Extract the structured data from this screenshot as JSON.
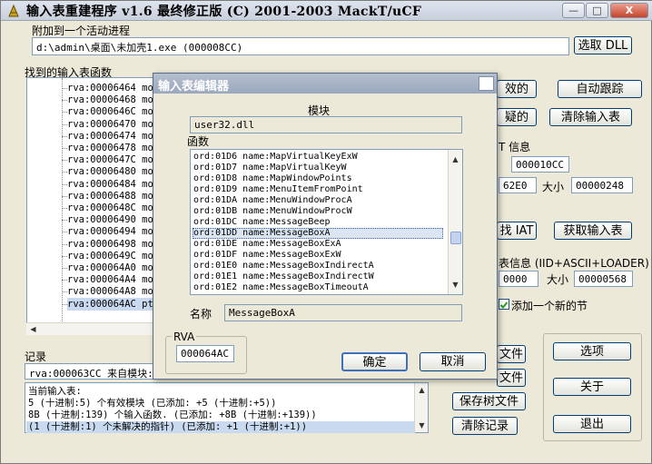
{
  "window": {
    "title": "输入表重建程序 v1.6 最终修正版 (C) 2001-2003 MackT/uCF",
    "min_label": "—",
    "max_label": "□",
    "close_label": "X"
  },
  "attach": {
    "label": "附加到一个活动进程",
    "process_value": "d:\\admin\\桌面\\未加壳1.exe (000008CC)",
    "pick_dll_button": "选取 DLL"
  },
  "tree": {
    "label": "找到的输入表函数",
    "rows": [
      "rva:00006464 mod",
      "rva:00006468 mod",
      "rva:0000646C mod",
      "rva:00006470 mod",
      "rva:00006474 mod",
      "rva:00006478 mod",
      "rva:0000647C mod",
      "rva:00006480 mod",
      "rva:00006484 mod",
      "rva:00006488 mod",
      "rva:0000648C mod",
      "rva:00006490 mod",
      "rva:00006494 mod",
      "rva:00006498 mod",
      "rva:0000649C mod",
      "rva:000064A0 mod",
      "rva:000064A4 mod",
      "rva:000064A8 mod",
      "rva:000064AC ptr"
    ],
    "selected_index": 18
  },
  "right_panel": {
    "show_valid_button": "效的",
    "auto_trace_button": "自动跟踪",
    "show_suspect_button": "疑的",
    "clear_imports_button": "清除输入表",
    "iat_info_label": "T 信息",
    "oep_value": "000010CC",
    "rva_value": "62E0",
    "size_label_1": "大小",
    "size_value_1": "00000248",
    "iat_autosearch_button": "找 IAT",
    "get_imports_button": "获取输入表",
    "new_import_info_label": "表信息 (IID+ASCII+LOADER)",
    "new_import_rva_value": "0000",
    "size_label_2": "大小",
    "size_value_2": "00000568",
    "add_section_label": "添加一个新的节",
    "add_section_checked": true
  },
  "log": {
    "label": "记录",
    "first_line": "rva:000063CC 来自模块:n",
    "lines": [
      "当前输入表:",
      "5 (十进制:5) 个有效模块 (已添加: +5 (十进制:+5))",
      "8B (十进制:139) 个输入函数. (已添加: +8B (十进制:+139))",
      "(1 (十进制:1) 个未解决的指针) (已添加: +1 (十进制:+1))"
    ]
  },
  "bottom_buttons": {
    "load_tree_button": "文件",
    "save_tree_file_button": "文件",
    "save_tree_button": "保存树文件",
    "clear_log_button": "清除记录",
    "options_button": "选项",
    "about_button": "关于",
    "exit_button": "退出"
  },
  "dialog": {
    "title": "输入表编辑器",
    "module_label": "模块",
    "module_value": "user32.dll",
    "functions_label": "函数",
    "functions": [
      "ord:01D6 name:MapVirtualKeyExW",
      "ord:01D7 name:MapVirtualKeyW",
      "ord:01D8 name:MapWindowPoints",
      "ord:01D9 name:MenuItemFromPoint",
      "ord:01DA name:MenuWindowProcA",
      "ord:01DB name:MenuWindowProcW",
      "ord:01DC name:MessageBeep",
      "ord:01DD name:MessageBoxA",
      "ord:01DE name:MessageBoxExA",
      "ord:01DF name:MessageBoxExW",
      "ord:01E0 name:MessageBoxIndirectA",
      "ord:01E1 name:MessageBoxIndirectW",
      "ord:01E2 name:MessageBoxTimeoutA"
    ],
    "selected_function_index": 7,
    "name_label": "名称",
    "name_value": "MessageBoxA",
    "rva_label": "RVA",
    "rva_value": "000064AC",
    "ok_button": "确定",
    "cancel_button": "取消"
  }
}
